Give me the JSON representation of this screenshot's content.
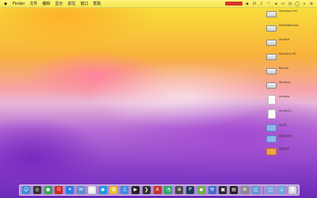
{
  "menubar": {
    "apple_icon": "apple-icon",
    "menus": [
      {
        "label": "Finder"
      },
      {
        "label": "文件"
      },
      {
        "label": "编辑"
      },
      {
        "label": "显示"
      },
      {
        "label": "前往"
      },
      {
        "label": "窗口"
      },
      {
        "label": "帮助"
      }
    ],
    "status_icons": [
      "app-icon",
      "dropbox-icon",
      "power-icon",
      "bluetooth-icon",
      "wifi-icon",
      "volume-icon",
      "battery-icon",
      "clock-icon",
      "user-icon",
      "search-icon",
      "notification-icon"
    ]
  },
  "desktop": {
    "items": [
      {
        "kind": "drive",
        "name": "Macintosh HD",
        "sub": ""
      },
      {
        "kind": "drive",
        "name": "MobileBackups",
        "sub": ""
      },
      {
        "kind": "drive",
        "name": "Untitled",
        "sub": ""
      },
      {
        "kind": "drive",
        "name": "Recovery HD",
        "sub": ""
      },
      {
        "kind": "drive",
        "name": "Backup",
        "sub": ""
      },
      {
        "kind": "drive",
        "name": "Windows",
        "sub": ""
      },
      {
        "kind": "doc",
        "name": "Untitled",
        "sub": ""
      },
      {
        "kind": "doc",
        "name": "Untitled 2",
        "sub": ""
      },
      {
        "kind": "folder",
        "name": "文件夹",
        "sub": ""
      },
      {
        "kind": "folder",
        "name": "新建文件夹",
        "sub": ""
      },
      {
        "kind": "archive",
        "name": "压缩文件",
        "sub": ""
      }
    ]
  },
  "dock": {
    "items": [
      {
        "name": "finder-icon",
        "color": "#3a8be0",
        "glyph": "☺"
      },
      {
        "name": "launchpad-icon",
        "color": "#333333",
        "glyph": "◎"
      },
      {
        "name": "chrome-icon",
        "color": "#2fa84f",
        "glyph": "●"
      },
      {
        "name": "opera-icon",
        "color": "#d4241f",
        "glyph": "O"
      },
      {
        "name": "safari-icon",
        "color": "#2c7be5",
        "glyph": "✦"
      },
      {
        "name": "mail-icon",
        "color": "#5a8fd8",
        "glyph": "✉"
      },
      {
        "name": "calendar-icon",
        "color": "#e9e9e9",
        "glyph": "▦"
      },
      {
        "name": "qq-icon",
        "color": "#1b9ae0",
        "glyph": "◉"
      },
      {
        "name": "photos-icon",
        "color": "#f1c232",
        "glyph": "✿"
      },
      {
        "name": "itunes-icon",
        "color": "#3d8de0",
        "glyph": "♫"
      },
      {
        "name": "movie-icon",
        "color": "#222222",
        "glyph": "▶"
      },
      {
        "name": "terminal-icon",
        "color": "#333333",
        "glyph": "❯"
      },
      {
        "name": "pdf-icon",
        "color": "#c9302c",
        "glyph": "A"
      },
      {
        "name": "wechat-icon",
        "color": "#2aae67",
        "glyph": "◔"
      },
      {
        "name": "network-icon",
        "color": "#4a4a4a",
        "glyph": "⊕"
      },
      {
        "name": "photoshop-icon",
        "color": "#1f3b5a",
        "glyph": "P"
      },
      {
        "name": "maps-icon",
        "color": "#6fb04a",
        "glyph": "◆"
      },
      {
        "name": "xcode-icon",
        "color": "#3a6fd0",
        "glyph": "⚒"
      },
      {
        "name": "monitor-icon",
        "color": "#2a2a2a",
        "glyph": "▣"
      },
      {
        "name": "console-icon",
        "color": "#222222",
        "glyph": "▤"
      },
      {
        "name": "settings-icon",
        "color": "#8a8a8a",
        "glyph": "⚙"
      },
      {
        "name": "preview-icon",
        "color": "#5f9ad8",
        "glyph": "◫"
      },
      {
        "name": "documents-icon",
        "color": "#7aa6df",
        "glyph": "▢"
      },
      {
        "name": "downloads-icon",
        "color": "#7aa6df",
        "glyph": "⇣"
      },
      {
        "name": "trash-icon",
        "color": "#d8d8d8",
        "glyph": "🗑"
      }
    ]
  }
}
